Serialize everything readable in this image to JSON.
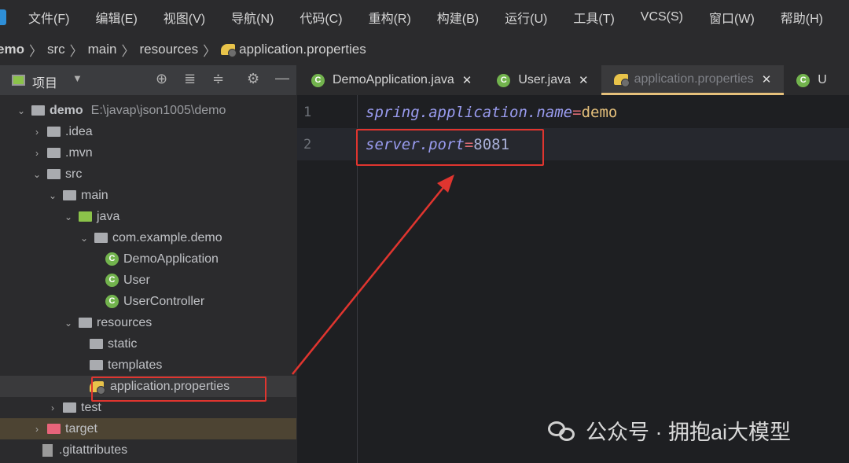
{
  "menu": [
    "文件(F)",
    "编辑(E)",
    "视图(V)",
    "导航(N)",
    "代码(C)",
    "重构(R)",
    "构建(B)",
    "运行(U)",
    "工具(T)",
    "VCS(S)",
    "窗口(W)",
    "帮助(H)"
  ],
  "breadcrumb": {
    "items": [
      "emo",
      "src",
      "main",
      "resources"
    ],
    "file": "application.properties"
  },
  "project_panel": {
    "title": "项目"
  },
  "tabs": [
    {
      "label": "DemoApplication.java",
      "icon": "spring-boot-class-icon"
    },
    {
      "label": "User.java",
      "icon": "class-icon"
    },
    {
      "label": "application.properties",
      "icon": "properties-icon",
      "active": true
    },
    {
      "label": "U",
      "icon": "class-icon"
    }
  ],
  "tree": [
    {
      "label": "demo",
      "path": "E:\\javap\\json1005\\demo",
      "type": "module",
      "indent": 0,
      "expanded": true
    },
    {
      "label": ".idea",
      "type": "folder",
      "indent": 1,
      "expanded": false
    },
    {
      "label": ".mvn",
      "type": "folder",
      "indent": 1,
      "expanded": false
    },
    {
      "label": "src",
      "type": "folder",
      "indent": 1,
      "expanded": true
    },
    {
      "label": "main",
      "type": "folder",
      "indent": 2,
      "expanded": true
    },
    {
      "label": "java",
      "type": "source-folder",
      "indent": 3,
      "expanded": true
    },
    {
      "label": "com.example.demo",
      "type": "package",
      "indent": 4,
      "expanded": true
    },
    {
      "label": "DemoApplication",
      "type": "class",
      "indent": 5
    },
    {
      "label": "User",
      "type": "class",
      "indent": 5
    },
    {
      "label": "UserController",
      "type": "class",
      "indent": 5
    },
    {
      "label": "resources",
      "type": "resource-folder",
      "indent": 3,
      "expanded": true
    },
    {
      "label": "static",
      "type": "folder",
      "indent": 4
    },
    {
      "label": "templates",
      "type": "folder",
      "indent": 4
    },
    {
      "label": "application.properties",
      "type": "properties",
      "indent": 4,
      "selected": true
    },
    {
      "label": "test",
      "type": "folder",
      "indent": 2,
      "expanded": false
    },
    {
      "label": "target",
      "type": "excluded-folder",
      "indent": 1,
      "expanded": false,
      "highlight": true
    },
    {
      "label": ".gitattributes",
      "type": "file",
      "indent": 1
    }
  ],
  "editor": {
    "lines": [
      {
        "number": "1",
        "key": "spring.application.name",
        "eq": "=",
        "value": "demo"
      },
      {
        "number": "2",
        "key": "server.port",
        "eq": "=",
        "value": "8081"
      }
    ]
  },
  "watermark": "公众号 · 拥抱ai大模型",
  "colors": {
    "annotation": "#e0352f",
    "selection": "#3a3a3c",
    "target_highlight": "#4d4433"
  }
}
